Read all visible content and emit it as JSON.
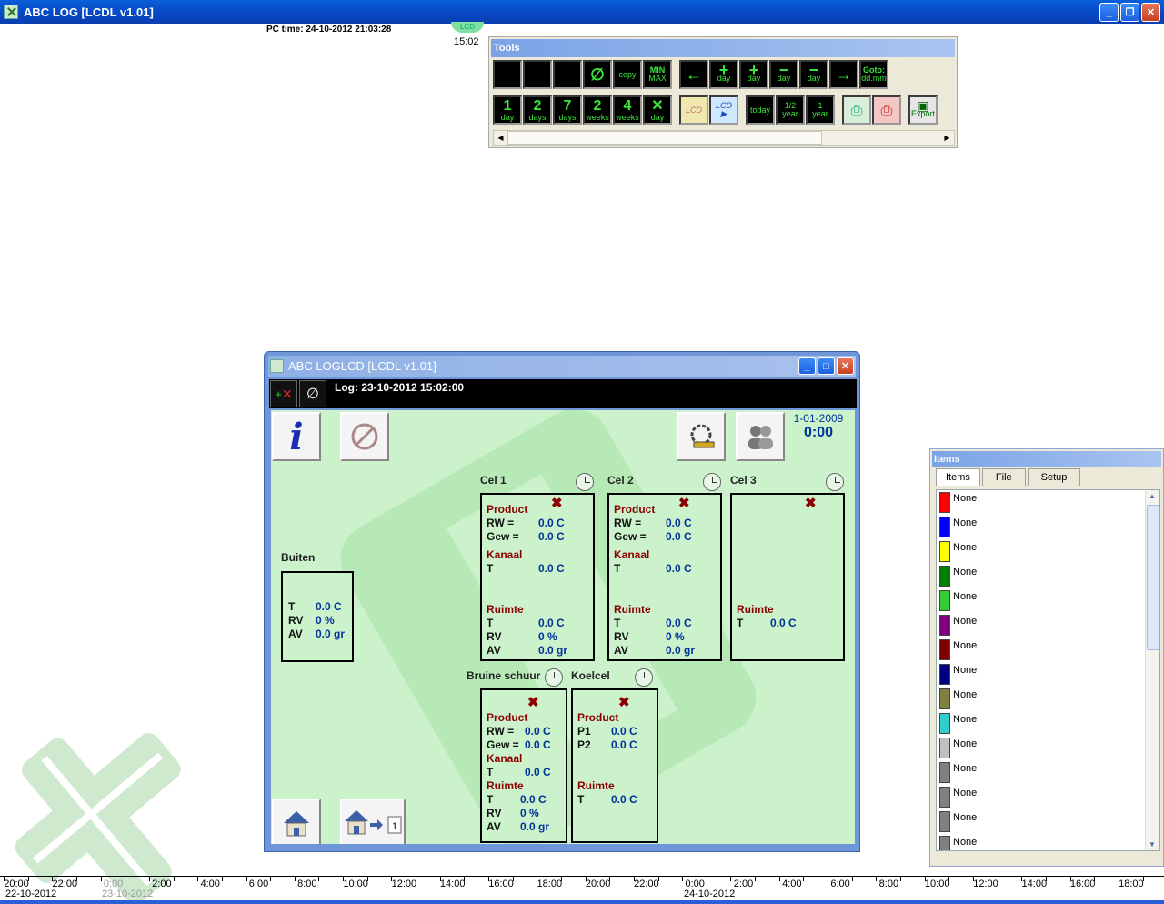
{
  "app": {
    "title": "ABC LOG [LCDL v1.01]"
  },
  "header": {
    "pc_time": "PC time: 24-10-2012 21:03:28",
    "cursor_marker": "LCD",
    "cursor_time": "15:02"
  },
  "tools": {
    "title": "Tools",
    "row1": [
      {
        "name": "edit",
        "l1": "",
        "l2": ""
      },
      {
        "name": "zoom-vertical",
        "l1": "",
        "l2": ""
      },
      {
        "name": "zoom-fit",
        "l1": "",
        "l2": ""
      },
      {
        "name": "no-filter",
        "l1": "∅",
        "l2": ""
      },
      {
        "name": "copy",
        "l1": "",
        "l2": "copy"
      },
      {
        "name": "min-max",
        "l1": "MIN",
        "l2": "MAX"
      },
      {
        "name": "back",
        "l1": "←",
        "l2": ""
      },
      {
        "name": "plus-day",
        "l1": "+",
        "l2": "day"
      },
      {
        "name": "plus-day-2",
        "l1": "+",
        "l2": "day"
      },
      {
        "name": "minus-day",
        "l1": "−",
        "l2": "day"
      },
      {
        "name": "minus-day-2",
        "l1": "−",
        "l2": "day"
      },
      {
        "name": "forward",
        "l1": "→",
        "l2": ""
      },
      {
        "name": "goto",
        "l1": "Goto:",
        "l2": "dd.mm"
      }
    ],
    "row2": [
      {
        "name": "1-day",
        "big": "1",
        "l2": "day"
      },
      {
        "name": "2-days",
        "big": "2",
        "l2": "days"
      },
      {
        "name": "7-days",
        "big": "7",
        "l2": "days"
      },
      {
        "name": "2-weeks",
        "big": "2",
        "l2": "weeks"
      },
      {
        "name": "4-weeks",
        "big": "4",
        "l2": "weeks"
      },
      {
        "name": "x-day",
        "big": "✕",
        "l2": "day"
      }
    ],
    "lcd_label": "LCD",
    "today_label": "today",
    "half_year": {
      "l1": "1/2",
      "l2": "year"
    },
    "one_year": {
      "l1": "1",
      "l2": "year"
    },
    "export_label": "Export"
  },
  "lcd_window": {
    "title": "ABC LOGLCD [LCDL v1.01]",
    "log_text": "Log: 23-10-2012 15:02:00",
    "date": "1-01-2009",
    "time": "0:00",
    "buiten": {
      "label": "Buiten",
      "rows": [
        {
          "l": "T",
          "v": "0.0 C"
        },
        {
          "l": "RV",
          "v": "0 %"
        },
        {
          "l": "AV",
          "v": "0.0 gr"
        }
      ]
    },
    "cel1": {
      "label": "Cel 1",
      "product": "Product",
      "rw": "RW =",
      "rw_v": "0.0 C",
      "gew": "Gew =",
      "gew_v": "0.0 C",
      "kanaal": "Kanaal",
      "kt": "T",
      "kt_v": "0.0 C",
      "ruimte": "Ruimte",
      "t": "T",
      "t_v": "0.0 C",
      "rv": "RV",
      "rv_v": "0 %",
      "av": "AV",
      "av_v": "0.0 gr"
    },
    "cel2": {
      "label": "Cel 2",
      "product": "Product",
      "rw": "RW =",
      "rw_v": "0.0 C",
      "gew": "Gew =",
      "gew_v": "0.0 C",
      "kanaal": "Kanaal",
      "kt": "T",
      "kt_v": "0.0 C",
      "ruimte": "Ruimte",
      "t": "T",
      "t_v": "0.0 C",
      "rv": "RV",
      "rv_v": "0 %",
      "av": "AV",
      "av_v": "0.0 gr"
    },
    "cel3": {
      "label": "Cel 3",
      "ruimte": "Ruimte",
      "t": "T",
      "t_v": "0.0 C"
    },
    "bruine": {
      "label": "Bruine schuur",
      "product": "Product",
      "rw": "RW =",
      "rw_v": "0.0 C",
      "gew": "Gew =",
      "gew_v": "0.0 C",
      "kanaal": "Kanaal",
      "kt": "T",
      "kt_v": "0.0 C",
      "ruimte": "Ruimte",
      "t": "T",
      "t_v": "0.0 C",
      "rv": "RV",
      "rv_v": "0 %",
      "av": "AV",
      "av_v": "0.0 gr"
    },
    "koelcel": {
      "label": "Koelcel",
      "product": "Product",
      "p1": "P1",
      "p1_v": "0.0 C",
      "p2": "P2",
      "p2_v": "0.0 C",
      "ruimte": "Ruimte",
      "t": "T",
      "t_v": "0.0 C"
    }
  },
  "items_window": {
    "title": "Items",
    "tabs": [
      "Items",
      "File",
      "Setup"
    ],
    "items": [
      {
        "label": "None",
        "color": "#ff0000"
      },
      {
        "label": "None",
        "color": "#0000ff"
      },
      {
        "label": "None",
        "color": "#ffff00"
      },
      {
        "label": "None",
        "color": "#008000"
      },
      {
        "label": "None",
        "color": "#33cc33"
      },
      {
        "label": "None",
        "color": "#800080"
      },
      {
        "label": "None",
        "color": "#800000"
      },
      {
        "label": "None",
        "color": "#000080"
      },
      {
        "label": "None",
        "color": "#808040"
      },
      {
        "label": "None",
        "color": "#33cccc"
      },
      {
        "label": "None",
        "color": "#c0c0c0"
      },
      {
        "label": "None",
        "color": "#808080"
      },
      {
        "label": "None",
        "color": "#808080"
      },
      {
        "label": "None",
        "color": "#808080"
      },
      {
        "label": "None",
        "color": "#808080"
      }
    ]
  },
  "timeline": {
    "labels": [
      "20:00",
      "22:00",
      "0:00",
      "2:00",
      "4:00",
      "6:00",
      "8:00",
      "10:00",
      "12:00",
      "14:00",
      "16:00",
      "18:00",
      "20:00",
      "22:00",
      "0:00",
      "2:00",
      "4:00",
      "6:00",
      "8:00",
      "10:00",
      "12:00",
      "14:00",
      "16:00",
      "18:00"
    ],
    "dates": [
      "22-10-2012",
      "23-10-2012",
      "24-10-2012"
    ]
  }
}
